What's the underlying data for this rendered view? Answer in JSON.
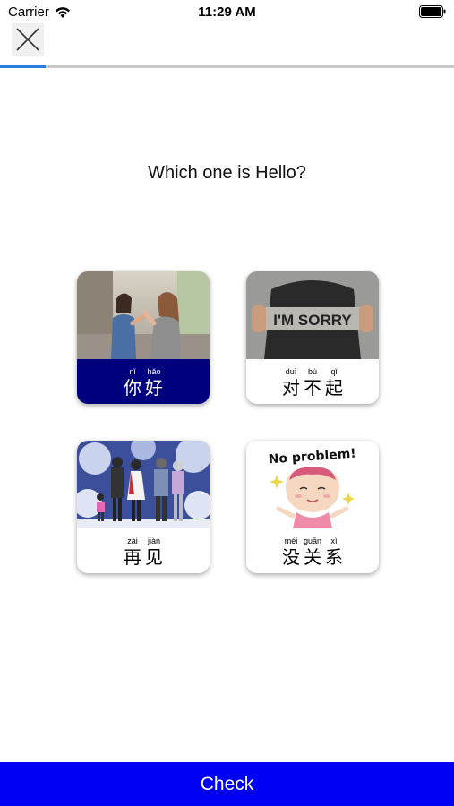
{
  "status_bar": {
    "carrier": "Carrier",
    "time": "11:29 AM"
  },
  "header": {
    "close_icon": "close-icon",
    "progress_fraction": 0.1
  },
  "question": "Which one is Hello?",
  "options": [
    {
      "id": "nihao",
      "image": "two-women-greeting-photo",
      "selected": true,
      "syllables": [
        {
          "pinyin": "nǐ",
          "hanzi": "你"
        },
        {
          "pinyin": "hǎo",
          "hanzi": "好"
        }
      ]
    },
    {
      "id": "duibuqi",
      "image": "im-sorry-sign-photo",
      "image_text": "I'M SORRY",
      "selected": false,
      "syllables": [
        {
          "pinyin": "duì",
          "hanzi": "对"
        },
        {
          "pinyin": "bù",
          "hanzi": "不"
        },
        {
          "pinyin": "qǐ",
          "hanzi": "起"
        }
      ]
    },
    {
      "id": "zaijian",
      "image": "family-waving-illustration",
      "selected": false,
      "syllables": [
        {
          "pinyin": "zài",
          "hanzi": "再"
        },
        {
          "pinyin": "jiàn",
          "hanzi": "见"
        }
      ]
    },
    {
      "id": "meiguanxi",
      "image": "no-problem-cartoon",
      "image_text": "No problem!",
      "selected": false,
      "syllables": [
        {
          "pinyin": "méi",
          "hanzi": "没"
        },
        {
          "pinyin": "guān",
          "hanzi": "关"
        },
        {
          "pinyin": "xì",
          "hanzi": "系"
        }
      ]
    }
  ],
  "footer": {
    "check_label": "Check"
  },
  "colors": {
    "selected_label_bg": "#00007f",
    "check_button_bg": "#0000f5",
    "progress_fill": "#2a7de1",
    "progress_track": "#c9c9c9"
  }
}
